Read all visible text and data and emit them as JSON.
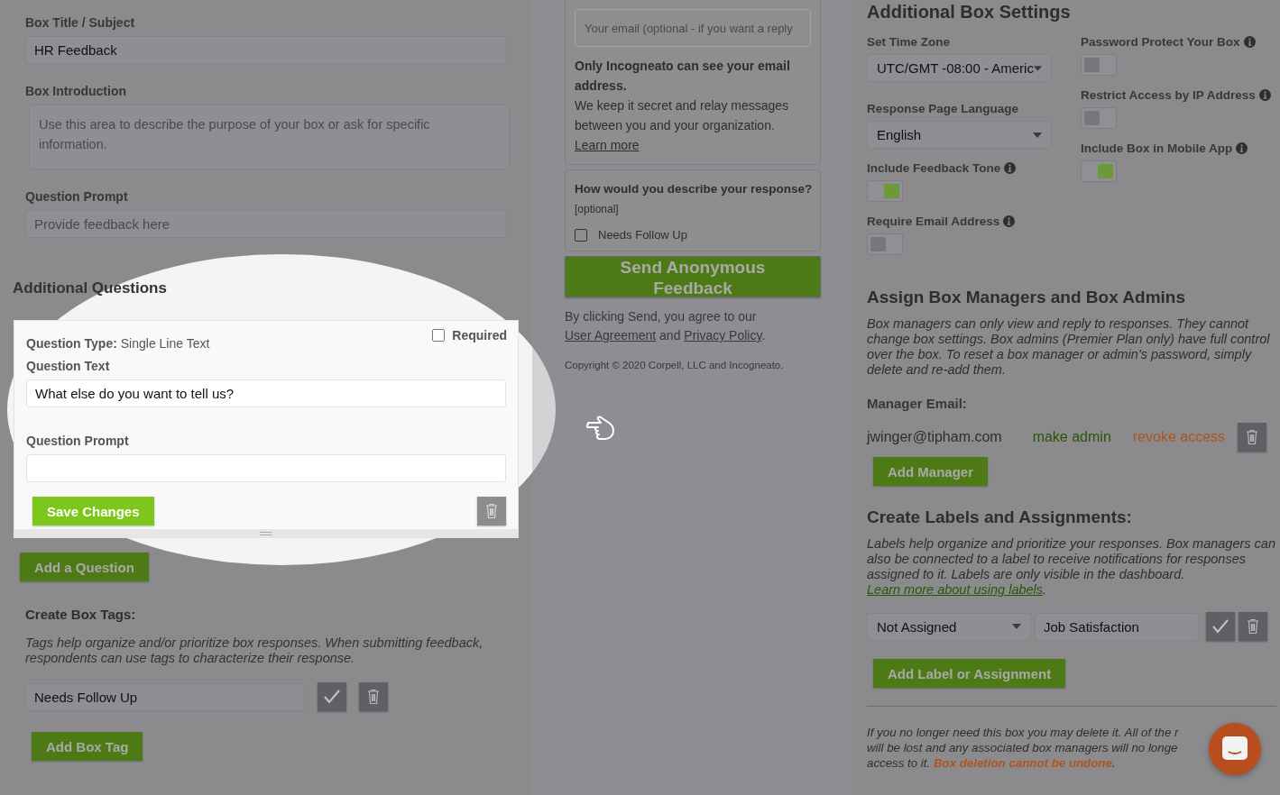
{
  "box_form": {
    "fields": [
      {
        "kind": "input",
        "label": "Box Title / Subject",
        "value": "HR Feedback"
      },
      {
        "kind": "textarea",
        "label": "Box Introduction",
        "placeholder": "Use this area to describe the purpose of your box or ask for specific information."
      },
      {
        "kind": "input",
        "label": "Question Prompt",
        "placeholder": "Provide feedback here"
      }
    ]
  },
  "additional_questions": {
    "title": "Additional Questions",
    "question": {
      "type_label": "Question Type:",
      "type_value": "Single Line Text",
      "required_label": "Required",
      "required": false,
      "text_label": "Question Text",
      "text_value": "What else do you want to tell us?",
      "prompt_label": "Question Prompt",
      "save_button": "Save Changes"
    },
    "add_button": "Add a Question"
  },
  "box_tags": {
    "title": "Create Box Tags:",
    "description": "Tags help organize and/or prioritize box responses. When submitting feedback, respondents can use tags to characterize their response.",
    "tags": [
      {
        "value": "Needs Follow Up"
      }
    ],
    "add_button": "Add Box Tag"
  },
  "response_form": {
    "email_placeholder": "Your email (optional - if you want a reply",
    "privacy_title": "Only Incogneato can see your email address.",
    "privacy_text": [
      {
        "kind": "text",
        "text": "We keep it secret and relay messages between you and your organization. "
      },
      {
        "kind": "link",
        "text": "Learn more"
      }
    ],
    "describe_title": "How would you describe your response?",
    "optional_note": "[optional]",
    "tag_options": [
      {
        "label": "Needs Follow Up",
        "checked": false
      }
    ],
    "send_button": "Send Anonymous Feedback",
    "agreement": [
      {
        "kind": "text",
        "text": "By clicking Send, you agree to our "
      },
      {
        "kind": "link",
        "text": "User Agreement"
      },
      {
        "kind": "text",
        "text": " and "
      },
      {
        "kind": "link",
        "text": "Privacy Policy"
      },
      {
        "kind": "text",
        "text": "."
      }
    ],
    "copyright": "Copyright © 2020 Corpell, LLC and Incogneato."
  },
  "settings": {
    "title": "Additional Box Settings",
    "time_zone": {
      "label": "Set Time Zone",
      "value": "UTC/GMT -08:00 - Americ"
    },
    "language": {
      "label": "Response Page Language",
      "value": "English"
    },
    "left_toggles": [
      {
        "label": "Include Feedback Tone",
        "on": true
      },
      {
        "label": "Require Email Address",
        "on": false
      }
    ],
    "right_toggles": [
      {
        "label": "Password Protect Your Box",
        "on": false
      },
      {
        "label": "Restrict Access by IP Address",
        "on": false
      },
      {
        "label": "Include Box in Mobile App",
        "on": true
      }
    ]
  },
  "managers": {
    "title": "Assign Box Managers and Box Admins",
    "description": "Box managers can only view and reply to responses. They cannot change box settings. Box admins (Premier Plan only) have full control over the box. To reset a box manager or admin's password, simply delete and re-add them.",
    "email_label": "Manager Email:",
    "list": [
      {
        "email": "jwinger@tipham.com",
        "make_admin": "make admin",
        "revoke": "revoke access"
      }
    ],
    "add_button": "Add Manager"
  },
  "labels": {
    "title": "Create Labels and Assignments:",
    "description": [
      {
        "kind": "text",
        "text": "Labels help organize and prioritize your responses. Box managers can also be connected to a label to receive notifications for responses assigned to it. Labels are only visible in the dashboard. "
      },
      {
        "kind": "link",
        "text": "Learn more about using labels"
      },
      {
        "kind": "text",
        "text": "."
      }
    ],
    "list": [
      {
        "assignee": "Not Assigned",
        "name": "Job Satisfaction"
      }
    ],
    "add_button": "Add Label or Assignment"
  },
  "delete_notice": {
    "lines": [
      "If you no longer need this box you may delete it. All of the r",
      "will be lost and any associated box managers will no longe",
      "access to it. **Box deletion cannot be undone**."
    ]
  }
}
